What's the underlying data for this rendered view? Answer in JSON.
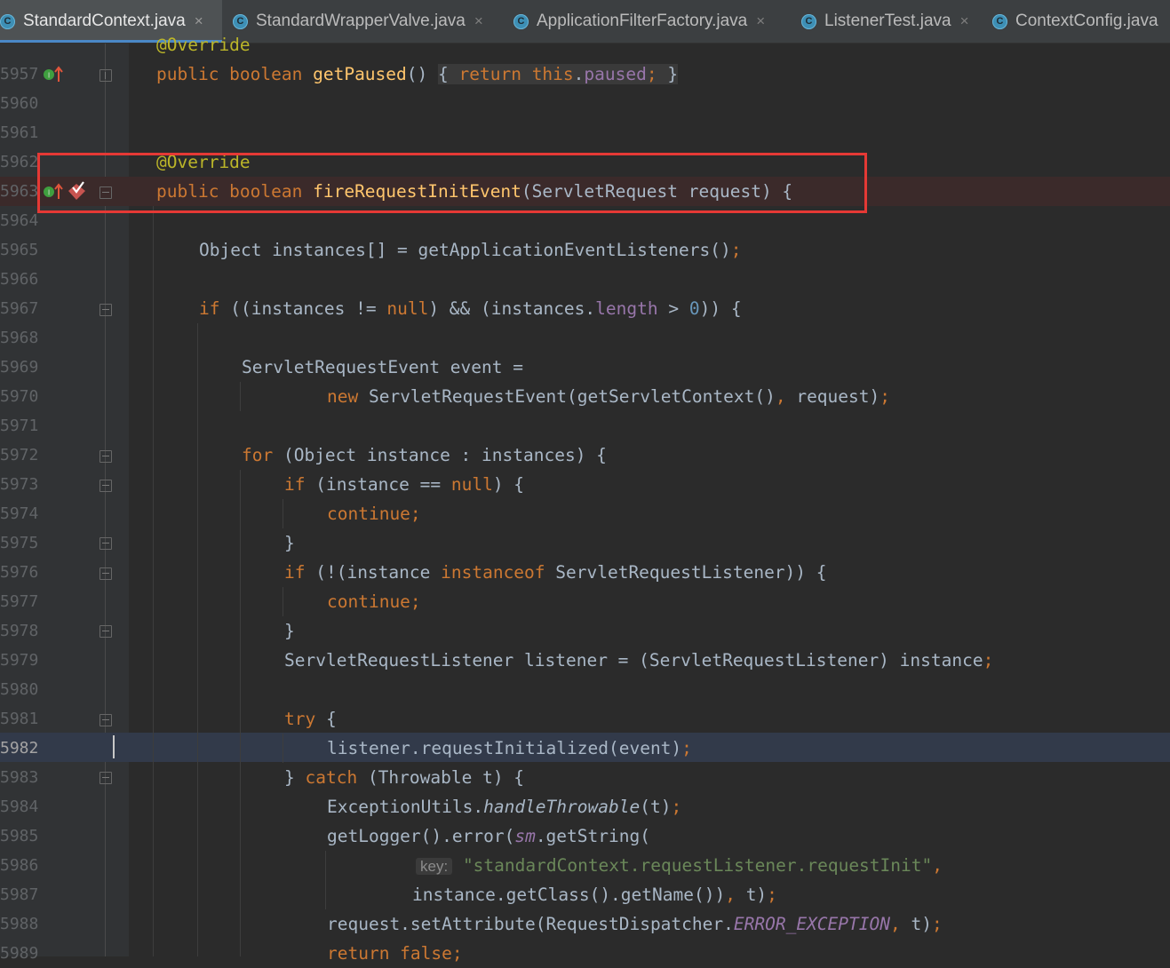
{
  "tabs": [
    {
      "label": "StandardContext.java",
      "active": true
    },
    {
      "label": "StandardWrapperValve.java",
      "active": false
    },
    {
      "label": "ApplicationFilterFactory.java",
      "active": false
    },
    {
      "label": "ListenerTest.java",
      "active": false
    },
    {
      "label": "ContextConfig.java",
      "active": false
    }
  ],
  "tab_icon_letter": "C",
  "close_glyph": "×",
  "line_numbers": [
    "5957",
    "5960",
    "5961",
    "5962",
    "5963",
    "5964",
    "5965",
    "5966",
    "5967",
    "5968",
    "5969",
    "5970",
    "5971",
    "5972",
    "5973",
    "5974",
    "5975",
    "5976",
    "5977",
    "5978",
    "5979",
    "5980",
    "5981",
    "5982",
    "5983",
    "5984",
    "5985",
    "5986",
    "5987",
    "5988",
    "5989"
  ],
  "current_line": "5982",
  "code": {
    "top_partial": "@Override",
    "l5957": {
      "p1": "public boolean ",
      "m": "getPaused",
      "p2": "() ",
      "b1": "{ ",
      "kw2": "return ",
      "kw3": "this",
      "dot": ".",
      "fld": "paused",
      "semi": ";",
      "b2": " }"
    },
    "l5962": "@Override",
    "l5963": {
      "kw": "public boolean ",
      "m": "fireRequestInitEvent",
      "rest": "(ServletRequest request) {"
    },
    "l5965": {
      "a": "Object instances[] = getApplicationEventListeners()",
      "semi": ";"
    },
    "l5967": {
      "kw": "if ",
      "a": "((instances != ",
      "n1": "null",
      "b": ") && (instances.",
      "fld": "length",
      "c": " > ",
      "num": "0",
      "d": ")) {"
    },
    "l5969": "ServletRequestEvent event =",
    "l5970": {
      "kw": "new ",
      "a": "ServletRequestEvent(getServletContext()",
      "comma": ", ",
      "b": "request)",
      "semi": ";"
    },
    "l5972": {
      "kw": "for ",
      "a": "(Object instance : instances) {"
    },
    "l5973": {
      "kw": "if ",
      "a": "(instance == ",
      "n": "null",
      "b": ") {"
    },
    "l5974": {
      "kw": "continue",
      "semi": ";"
    },
    "l5975": "}",
    "l5976": {
      "kw": "if ",
      "a": "(!(instance ",
      "kw2": "instanceof ",
      "b": "ServletRequestListener)) {"
    },
    "l5977": {
      "kw": "continue",
      "semi": ";"
    },
    "l5978": "}",
    "l5979": {
      "a": "ServletRequestListener listener = (ServletRequestListener) instance",
      "semi": ";"
    },
    "l5981": {
      "kw": "try ",
      "a": "{"
    },
    "l5982": {
      "a": "listener.requestInitialized(event)",
      "semi": ";"
    },
    "l5983": {
      "a": "} ",
      "kw": "catch ",
      "b": "(Throwable t) {"
    },
    "l5984": {
      "a": "ExceptionUtils.",
      "st": "handleThrowable",
      "b": "(t)",
      "semi": ";"
    },
    "l5985": {
      "a": "getLogger().error(",
      "cst": "sm",
      "b": ".getString("
    },
    "l5986": {
      "hint": "key:",
      "str": "\"standardContext.requestListener.requestInit\"",
      "comma": ","
    },
    "l5987": {
      "a": "instance.getClass().getName())",
      "comma": ", ",
      "b": "t)",
      "semi": ";"
    },
    "l5988": {
      "a": "request.setAttribute(RequestDispatcher.",
      "cst": "ERROR_EXCEPTION",
      "comma": ", ",
      "b": "t)",
      "semi": ";"
    },
    "l5989": {
      "kw": "return false",
      "semi": ";"
    }
  }
}
